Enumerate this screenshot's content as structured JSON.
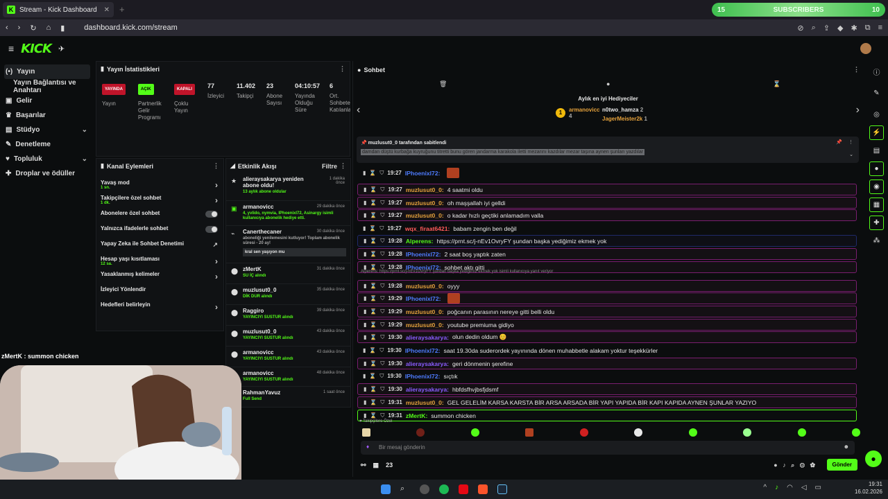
{
  "browser": {
    "tab_title": "Stream - Kick Dashboard",
    "url": "dashboard.kick.com/stream"
  },
  "subs_bar": {
    "left": "15",
    "label": "SUBSCRIBERS",
    "right": "10"
  },
  "sidebar": {
    "items": [
      {
        "label": "Yayın"
      },
      {
        "label": "Yayın Bağlantısı ve Anahtarı"
      },
      {
        "label": "Gelir"
      },
      {
        "label": "Başarılar"
      },
      {
        "label": "Stüdyo"
      },
      {
        "label": "Denetleme"
      },
      {
        "label": "Topluluk"
      },
      {
        "label": "Droplar ve ödüller"
      }
    ]
  },
  "stats": {
    "title": "Yayın İstatistikleri",
    "badges": [
      {
        "label": "YAYINDA",
        "caption": "Yayın"
      },
      {
        "label": "AÇIK",
        "caption": "Partnerlik Gelir Programı"
      },
      {
        "label": "KAPALI",
        "caption": "Çoklu Yayın"
      }
    ],
    "values": [
      {
        "v": "77",
        "k": "İzleyici"
      },
      {
        "v": "11.402",
        "k": "Takipçi"
      },
      {
        "v": "23",
        "k": "Abone Sayısı"
      },
      {
        "v": "04:10:57",
        "k": "Yayında Olduğu Süre"
      },
      {
        "v": "6",
        "k": "Ort. Sohbete Katılanla"
      }
    ]
  },
  "actions": {
    "title": "Kanal Eylemleri",
    "rows": [
      {
        "label": "Yavaş mod",
        "sub": "1 sn."
      },
      {
        "label": "Takipçilere özel sohbet",
        "sub": "1 dk."
      },
      {
        "label": "Abonelere özel sohbet",
        "sub": ""
      },
      {
        "label": "Yalnızca ifadelerle sohbet",
        "sub": ""
      },
      {
        "label": "Yapay Zeka ile Sohbet Denetimi",
        "sub": ""
      },
      {
        "label": "Hesap yaşı kısıtlaması",
        "sub": "12 sa."
      },
      {
        "label": "Yasaklanmış kelimeler",
        "sub": ""
      },
      {
        "label": "İzleyici Yönlendir",
        "sub": ""
      },
      {
        "label": "Hedefleri belirleyin",
        "sub": ""
      }
    ]
  },
  "activity": {
    "title": "Etkinlik Akışı",
    "filter": "Filtre",
    "items": [
      {
        "name": "alieraysakarya yeniden abone oldu!",
        "desc": "13 aylık abone oldular",
        "time": "1 dakika önce"
      },
      {
        "name": "armanovicc",
        "desc": "4, yvlido, nymvia, IPhoenixl72, Asinargy isimli kullanıcıya abonelik hediye etti.",
        "time": "29 dakika önce"
      },
      {
        "name": "Canerthecaner",
        "desc": "aboneliği yenilemesini kutluyor! Toplam abonelik süresi - 20 ay!",
        "time": "30 dakika önce",
        "quote": "kral sen yaşıyon mu"
      },
      {
        "name": "zMertK",
        "desc": "SU İÇ alındı",
        "time": "31 dakika önce"
      },
      {
        "name": "muzlusut0_0",
        "desc": "DİK DUR alındı",
        "time": "35 dakika önce"
      },
      {
        "name": "Raggiro",
        "desc": "YAYINCIYI SUSTUR alındı",
        "time": "39 dakika önce"
      },
      {
        "name": "muzlusut0_0",
        "desc": "YAYINCIYI SUSTUR alındı",
        "time": "43 dakika önce"
      },
      {
        "name": "armanovicc",
        "desc": "YAYINCIYI SUSTUR alındı",
        "time": "43 dakika önce"
      },
      {
        "name": "armanovicc",
        "desc": "YAYINCIYI SUSTUR alındı",
        "time": "48 dakika önce"
      },
      {
        "name": "RahmanYavuz",
        "desc": "Full Send",
        "time": "1 saat önce"
      }
    ]
  },
  "chat": {
    "title": "Sohbet",
    "gifters_title": "Aylık en iyi Hediyeciler",
    "gifters": [
      {
        "rank": "1",
        "name": "armanovicc",
        "n": "4"
      },
      {
        "name": "n0two_hamza",
        "n": "2"
      },
      {
        "name": "JagerMeister2k",
        "n": "1"
      }
    ],
    "pinned_by": "muzlusut0_0 tarafından sabitlendi",
    "pinned_text": "damdan düştü kurbağa kuyruğunu titretti bunu gören jandarma karakola iletti mezarını kazdılar mezar taşına aynen şunları yazdılar",
    "reply_note": "Alperens: https://prnt.sc/j-nEv1OvryFY şundan başka yediğimiz ekmek yok isimli kullanıcıya yanıt veriyor",
    "messages": [
      {
        "time": "19:27",
        "user": "IPhoenixl72",
        "color": "#4e7cff",
        "text": "",
        "style": "plain",
        "emote": true
      },
      {
        "time": "19:27",
        "user": "muzlusut0_0",
        "color": "#e6a23c",
        "text": "4 saatmi oldu",
        "style": "pink"
      },
      {
        "time": "19:27",
        "user": "muzlusut0_0",
        "color": "#e6a23c",
        "text": "oh maşşallah iyi gelldi",
        "style": "pink"
      },
      {
        "time": "19:27",
        "user": "muzlusut0_0",
        "color": "#e6a23c",
        "text": "o kadar hızlı geçtiki anlamadım valla",
        "style": "pink"
      },
      {
        "time": "19:27",
        "user": "wqx_firaat6421",
        "color": "#ff5a5a",
        "text": "babam zengin ben değil",
        "style": "plain"
      },
      {
        "time": "19:28",
        "user": "Alperens",
        "color": "#53fc18",
        "text": "https://prnt.sc/j-nEv1OvryFY şundan başka yediğimiz ekmek yok",
        "style": "blue"
      },
      {
        "time": "19:28",
        "user": "IPhoenixl72",
        "color": "#4e7cff",
        "text": "2 saat boş yaptık zaten",
        "style": "pink"
      },
      {
        "time": "19:28",
        "user": "IPhoenixl72",
        "color": "#4e7cff",
        "text": "sohbet aktı gitti",
        "style": "pink"
      },
      {
        "time": "19:28",
        "user": "muzlusut0_0",
        "color": "#e6a23c",
        "text": "oyyy",
        "style": "pink"
      },
      {
        "time": "19:29",
        "user": "IPhoenixl72",
        "color": "#4e7cff",
        "text": "",
        "style": "pink",
        "emote": true
      },
      {
        "time": "19:29",
        "user": "muzlusut0_0",
        "color": "#e6a23c",
        "text": "poğcanın parasının nereye gitti belli oldu",
        "style": "pink"
      },
      {
        "time": "19:29",
        "user": "muzlusut0_0",
        "color": "#e6a23c",
        "text": "youtube premiuma gidiyo",
        "style": "pink"
      },
      {
        "time": "19:30",
        "user": "alieraysakarya",
        "color": "#8a5cff",
        "text": "olun dedin oldum 😊",
        "style": "pink"
      },
      {
        "time": "19:30",
        "user": "IPhoenixl72",
        "color": "#4e7cff",
        "text": "saat 19.30da suderordek yayınında dönen muhabbetle alakam yoktur teşekkürler",
        "style": "plain"
      },
      {
        "time": "19:30",
        "user": "alieraysakarya",
        "color": "#8a5cff",
        "text": "geri dönmenin şerefine",
        "style": "pink"
      },
      {
        "time": "19:30",
        "user": "IPhoenixl72",
        "color": "#4e7cff",
        "text": "sıçtık",
        "style": "plain"
      },
      {
        "time": "19:30",
        "user": "alieraysakarya",
        "color": "#8a5cff",
        "text": "hbfdsfhvjbsfjdsmf",
        "style": "pink"
      },
      {
        "time": "19:31",
        "user": "muzlusut0_0",
        "color": "#e6a23c",
        "text": "GEL GELELİM KARSA KARSTA BİR ARSA ARSADA BİR YAPI YAPIDA BİR KAPI KAPIDA AYNEN ŞUNLAR YAZIYO",
        "style": "pink"
      },
      {
        "time": "19:31",
        "user": "zMertK",
        "color": "#53fc18",
        "text": "summon chicken",
        "style": "greenb"
      }
    ],
    "follower_label": "Takipçilere Özel",
    "input_placeholder": "Bir mesaj gönderin",
    "viewer_count": "23",
    "send_label": "Gönder"
  },
  "webcam_overlay": "zMertK : summon chicken",
  "clock": {
    "time": "19:31",
    "date": "16.02.2026"
  }
}
